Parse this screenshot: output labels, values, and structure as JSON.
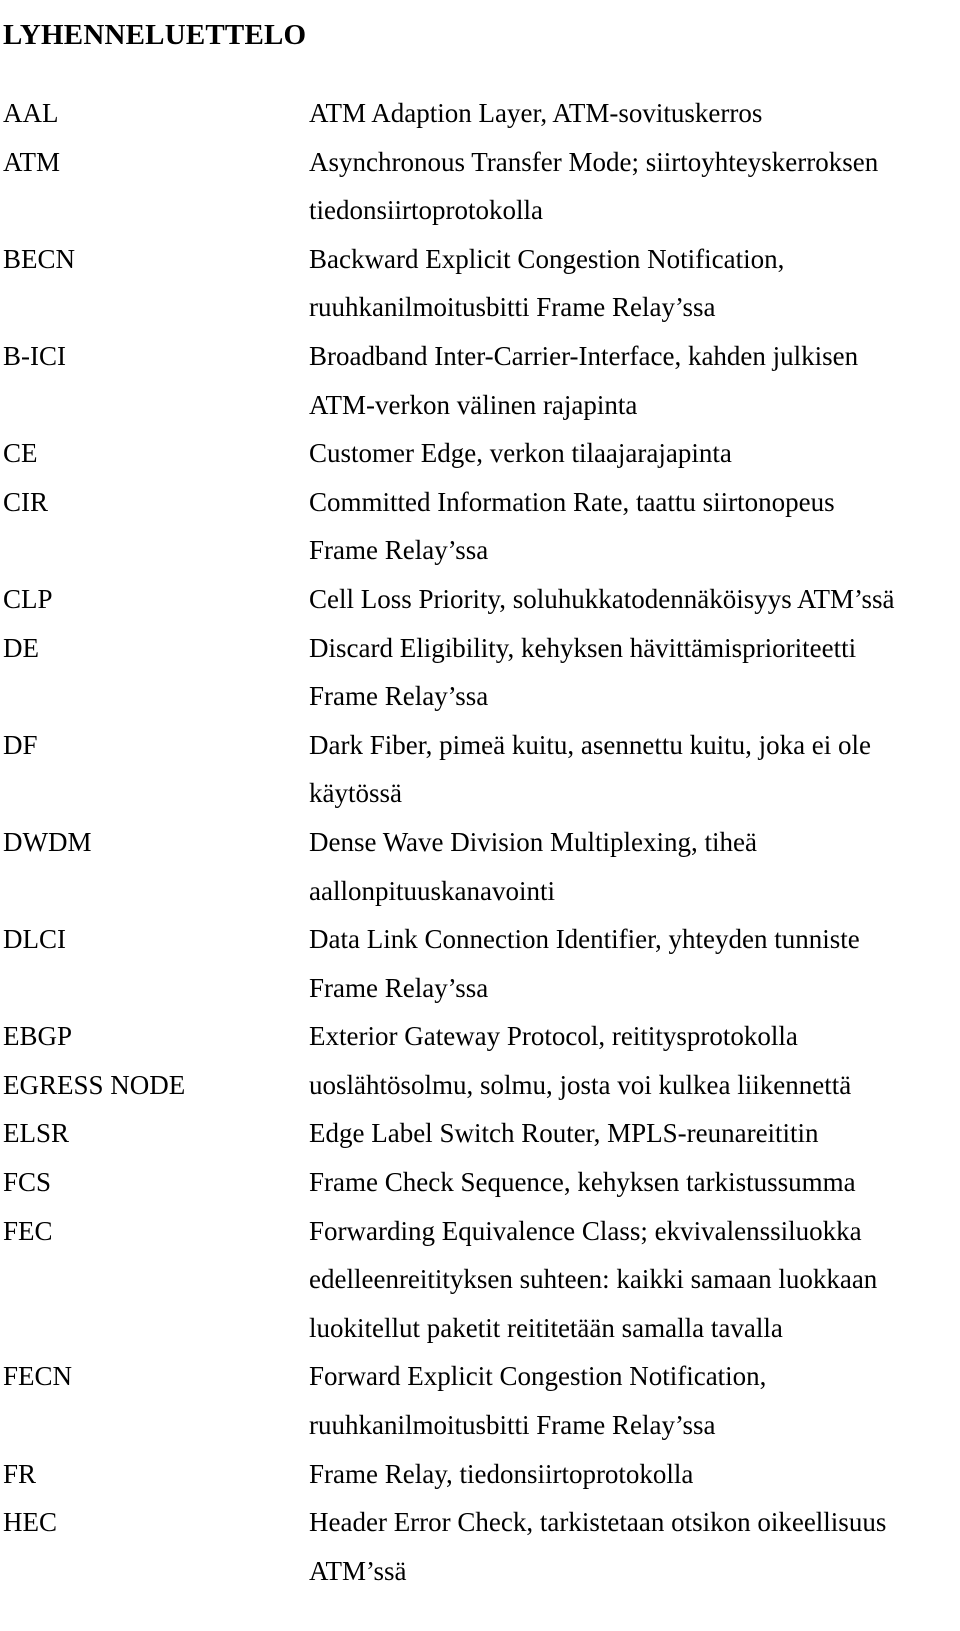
{
  "document": {
    "title": "LYHENNELUETTELO",
    "language": "fi",
    "entries": [
      {
        "term": "AAL",
        "definition_lines": [
          "ATM Adaption Layer, ATM-sovituskerros"
        ]
      },
      {
        "term": "ATM",
        "definition_lines": [
          "Asynchronous Transfer Mode; siirtoyhteyskerroksen",
          "tiedonsiirtoprotokolla"
        ]
      },
      {
        "term": "BECN",
        "definition_lines": [
          "Backward Explicit Congestion Notification,",
          "ruuhkanilmoitusbitti Frame Relay’ssa"
        ]
      },
      {
        "term": "B-ICI",
        "definition_lines": [
          "Broadband Inter-Carrier-Interface, kahden julkisen",
          "ATM-verkon välinen rajapinta"
        ]
      },
      {
        "term": "CE",
        "definition_lines": [
          "Customer Edge, verkon tilaajarajapinta"
        ]
      },
      {
        "term": "CIR",
        "definition_lines": [
          "Committed Information Rate, taattu siirtonopeus",
          "Frame Relay’ssa"
        ]
      },
      {
        "term": "CLP",
        "definition_lines": [
          "Cell Loss Priority, soluhukkatodennäköisyys ATM’ssä"
        ]
      },
      {
        "term": "DE",
        "definition_lines": [
          "Discard Eligibility, kehyksen hävittämisprioriteetti",
          "Frame Relay’ssa"
        ]
      },
      {
        "term": "DF",
        "definition_lines": [
          "Dark Fiber, pimeä kuitu, asennettu kuitu, joka ei ole",
          "käytössä"
        ]
      },
      {
        "term": "DWDM",
        "definition_lines": [
          "Dense Wave Division Multiplexing, tiheä",
          "aallonpituuskanavointi"
        ]
      },
      {
        "term": "DLCI",
        "definition_lines": [
          "Data Link Connection Identifier, yhteyden tunniste",
          "Frame Relay’ssa"
        ]
      },
      {
        "term": "EBGP",
        "definition_lines": [
          "Exterior Gateway Protocol, reititysprotokolla"
        ]
      },
      {
        "term": "EGRESS NODE",
        "definition_lines": [
          "uoslähtösolmu, solmu, josta voi kulkea liikennettä"
        ]
      },
      {
        "term": "ELSR",
        "definition_lines": [
          "Edge Label Switch Router, MPLS-reunareititin"
        ]
      },
      {
        "term": "FCS",
        "definition_lines": [
          "Frame Check Sequence, kehyksen tarkistussumma"
        ]
      },
      {
        "term": "FEC",
        "definition_lines": [
          "Forwarding Equivalence Class; ekvivalenssiluokka",
          "edelleenreitityksen suhteen: kaikki samaan luokkaan",
          "luokitellut paketit reititetään samalla tavalla"
        ]
      },
      {
        "term": "FECN",
        "definition_lines": [
          "Forward Explicit Congestion Notification,",
          "ruuhkanilmoitusbitti Frame Relay’ssa"
        ]
      },
      {
        "term": "FR",
        "definition_lines": [
          "Frame Relay, tiedonsiirtoprotokolla"
        ]
      },
      {
        "term": "HEC",
        "definition_lines": [
          "Header Error Check, tarkistetaan otsikon oikeellisuus",
          "ATM’ssä"
        ]
      }
    ]
  }
}
